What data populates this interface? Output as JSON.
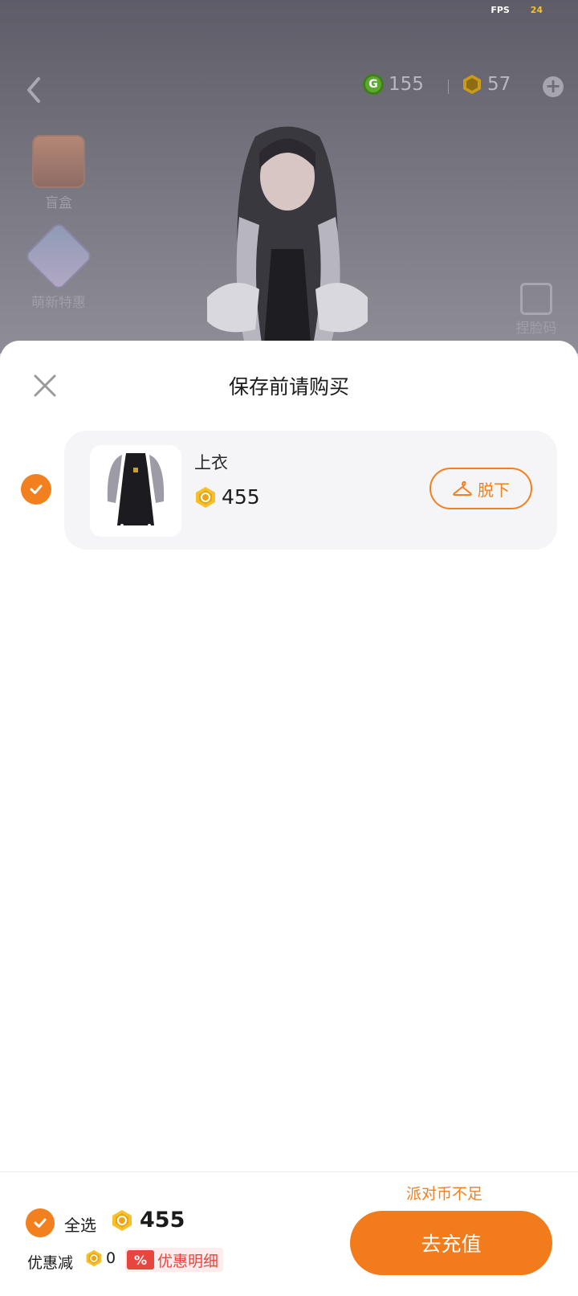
{
  "status": {
    "fps_label": "FPS",
    "fps_value": "24"
  },
  "topbar": {
    "green_currency": "155",
    "gold_currency": "57"
  },
  "side": {
    "blindbox_label": "盲盒",
    "newbie_label": "萌新特惠",
    "face_label": "捏脸码"
  },
  "sheet": {
    "title": "保存前请购买",
    "item": {
      "name": "上衣",
      "price": "455",
      "takeoff_label": "脱下"
    }
  },
  "footer": {
    "insufficient_text": "派对币不足",
    "select_all_label": "全选",
    "total_price": "455",
    "discount_label": "优惠减",
    "discount_value": "0",
    "discount_badge": "%",
    "discount_detail_label": "优惠明细",
    "recharge_label": "去充值"
  },
  "colors": {
    "accent": "#f2801f",
    "discount_red": "#e8453f"
  }
}
